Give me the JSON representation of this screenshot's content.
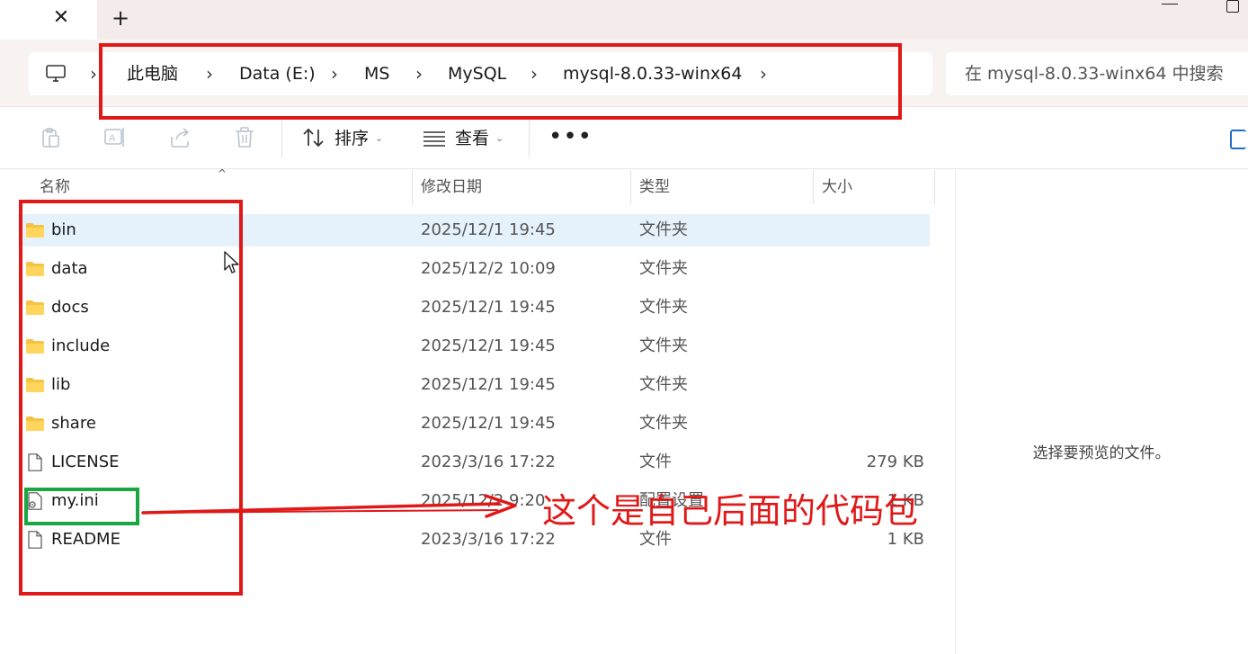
{
  "tab": {
    "close": "✕",
    "new_tab": "+"
  },
  "breadcrumb": {
    "items": [
      {
        "label": "此电脑"
      },
      {
        "label": "Data (E:)"
      },
      {
        "label": "MS"
      },
      {
        "label": "MySQL"
      },
      {
        "label": "mysql-8.0.33-winx64"
      }
    ],
    "separator": "›"
  },
  "search": {
    "placeholder": "在 mysql-8.0.33-winx64 中搜索"
  },
  "toolbar": {
    "sort_label": "排序",
    "view_label": "查看",
    "more_label": "•••",
    "caret": "⌄"
  },
  "columns": {
    "name": "名称",
    "date": "修改日期",
    "type": "类型",
    "size": "大小"
  },
  "files": [
    {
      "name": "bin",
      "date": "2025/12/1 19:45",
      "type": "文件夹",
      "size": "",
      "icon": "folder-icon",
      "selected": true
    },
    {
      "name": "data",
      "date": "2025/12/2 10:09",
      "type": "文件夹",
      "size": "",
      "icon": "folder-icon"
    },
    {
      "name": "docs",
      "date": "2025/12/1 19:45",
      "type": "文件夹",
      "size": "",
      "icon": "folder-icon"
    },
    {
      "name": "include",
      "date": "2025/12/1 19:45",
      "type": "文件夹",
      "size": "",
      "icon": "folder-icon"
    },
    {
      "name": "lib",
      "date": "2025/12/1 19:45",
      "type": "文件夹",
      "size": "",
      "icon": "folder-icon"
    },
    {
      "name": "share",
      "date": "2025/12/1 19:45",
      "type": "文件夹",
      "size": "",
      "icon": "folder-icon"
    },
    {
      "name": "LICENSE",
      "date": "2023/3/16 17:22",
      "type": "文件",
      "size": "279 KB",
      "icon": "file-icon"
    },
    {
      "name": "my.ini",
      "date": "2025/12/2 9:20",
      "type": "配置设置",
      "size": "1 KB",
      "icon": "settings-file-icon"
    },
    {
      "name": "README",
      "date": "2023/3/16 17:22",
      "type": "文件",
      "size": "1 KB",
      "icon": "file-icon"
    }
  ],
  "preview": {
    "empty_text": "选择要预览的文件。"
  },
  "annotation": {
    "text": "这个是自己后面的代码包"
  },
  "colors": {
    "annotation_red": "#e01818",
    "annotation_green": "#1aa640",
    "folder_yellow": "#f5c242",
    "selection": "#e5f1fb",
    "accent_blue": "#1f6fd0"
  }
}
